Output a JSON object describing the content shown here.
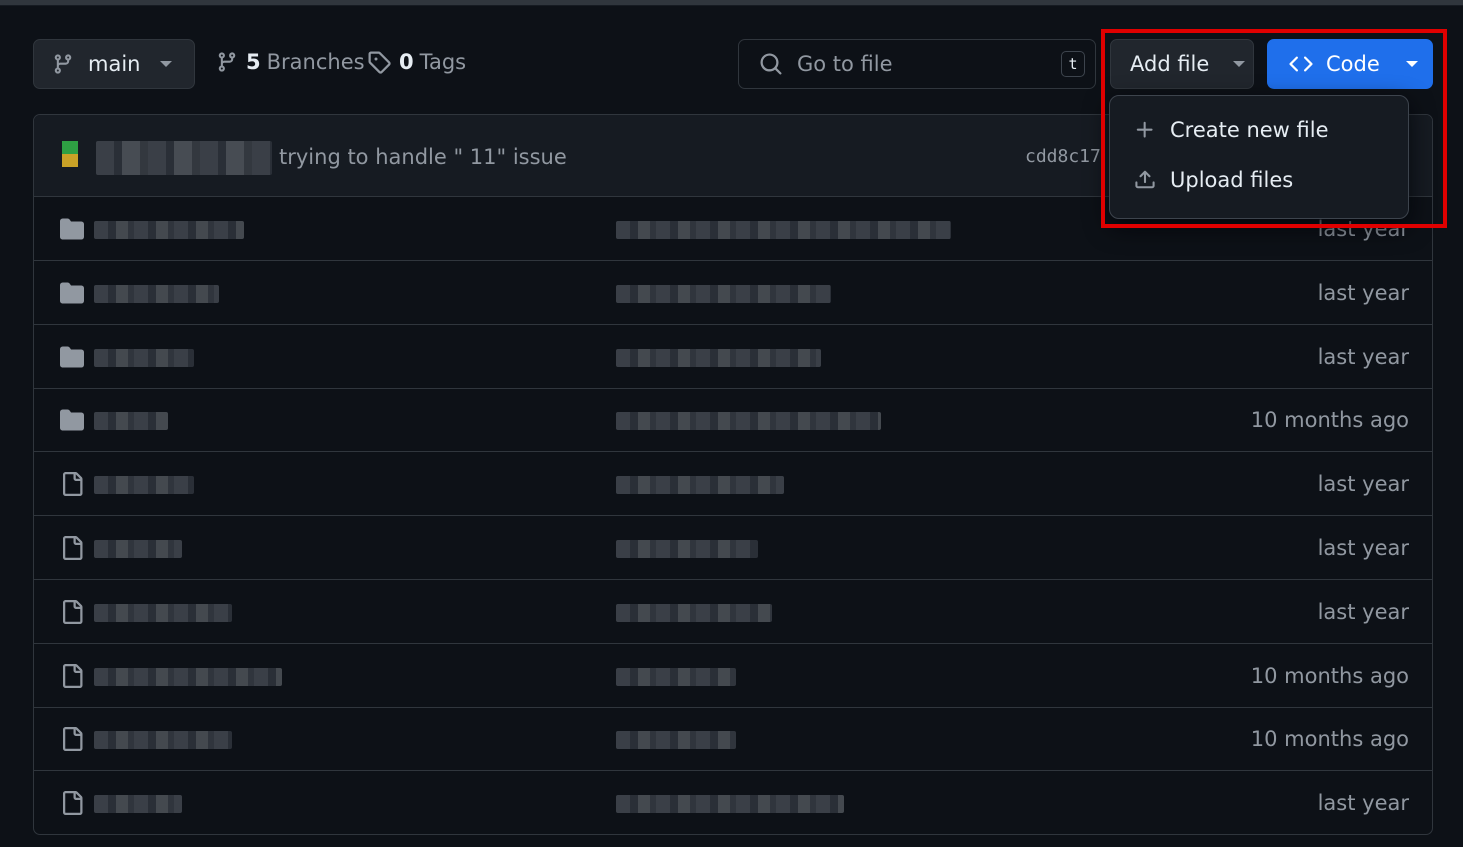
{
  "toolbar": {
    "branch": "main",
    "branches_count": "5",
    "branches_label": "Branches",
    "tags_count": "0",
    "tags_label": "Tags",
    "search_placeholder": "Go to file",
    "search_shortcut": "t",
    "add_file_label": "Add file",
    "code_label": "Code"
  },
  "commit": {
    "message": "trying to handle \" 11\" issue",
    "sha": "cdd8c17"
  },
  "files": [
    {
      "type": "folder",
      "time": "last year"
    },
    {
      "type": "folder",
      "time": "last year"
    },
    {
      "type": "folder",
      "time": "last year"
    },
    {
      "type": "folder",
      "time": "10 months ago"
    },
    {
      "type": "file",
      "time": "last year"
    },
    {
      "type": "file",
      "time": "last year"
    },
    {
      "type": "file",
      "time": "last year"
    },
    {
      "type": "file",
      "time": "10 months ago"
    },
    {
      "type": "file",
      "time": "10 months ago"
    },
    {
      "type": "file",
      "time": "last year"
    }
  ],
  "add_file_menu": {
    "items": [
      {
        "label": "Create new file",
        "icon": "plus-icon"
      },
      {
        "label": "Upload files",
        "icon": "upload-icon"
      }
    ]
  },
  "colors": {
    "background": "#0d1117",
    "code_button": "#1f6feb",
    "highlight": "#e00000"
  }
}
